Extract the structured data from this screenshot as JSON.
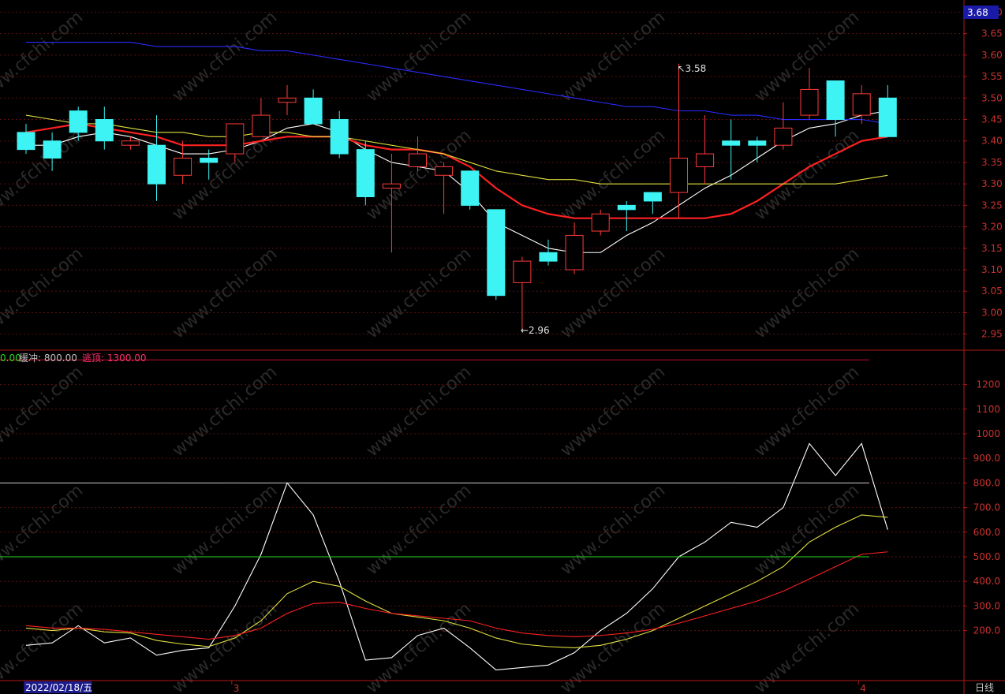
{
  "chart_data": {
    "type": "candlestick",
    "period_label": "日线",
    "watermark": "www.cfchi.com",
    "x_labels": [
      {
        "index": 1,
        "text": "2022/02/18/五"
      },
      {
        "index": 8,
        "text": "3"
      },
      {
        "index": 32,
        "text": "4"
      }
    ],
    "price_panel": {
      "current_price_label": "3.68",
      "ylim": [
        2.92,
        3.71
      ],
      "yticks": [
        "3.70",
        "3.65",
        "3.60",
        "3.55",
        "3.50",
        "3.45",
        "3.40",
        "3.35",
        "3.30",
        "3.25",
        "3.20",
        "3.15",
        "3.10",
        "3.05",
        "3.00",
        "2.95"
      ],
      "high_marker": {
        "index": 25,
        "text": "3.58"
      },
      "low_marker": {
        "index": 19,
        "text": "2.96"
      },
      "candles": [
        {
          "o": 3.42,
          "h": 3.44,
          "l": 3.37,
          "c": 3.38
        },
        {
          "o": 3.4,
          "h": 3.42,
          "l": 3.33,
          "c": 3.36
        },
        {
          "o": 3.47,
          "h": 3.48,
          "l": 3.4,
          "c": 3.42
        },
        {
          "o": 3.45,
          "h": 3.48,
          "l": 3.38,
          "c": 3.4
        },
        {
          "o": 3.39,
          "h": 3.41,
          "l": 3.38,
          "c": 3.4
        },
        {
          "o": 3.39,
          "h": 3.46,
          "l": 3.26,
          "c": 3.3
        },
        {
          "o": 3.32,
          "h": 3.4,
          "l": 3.3,
          "c": 3.36
        },
        {
          "o": 3.36,
          "h": 3.38,
          "l": 3.31,
          "c": 3.35
        },
        {
          "o": 3.37,
          "h": 3.4,
          "l": 3.35,
          "c": 3.44
        },
        {
          "o": 3.41,
          "h": 3.5,
          "l": 3.41,
          "c": 3.46
        },
        {
          "o": 3.49,
          "h": 3.53,
          "l": 3.46,
          "c": 3.5
        },
        {
          "o": 3.5,
          "h": 3.52,
          "l": 3.44,
          "c": 3.44
        },
        {
          "o": 3.45,
          "h": 3.47,
          "l": 3.36,
          "c": 3.37
        },
        {
          "o": 3.38,
          "h": 3.4,
          "l": 3.25,
          "c": 3.27
        },
        {
          "o": 3.29,
          "h": 3.37,
          "l": 3.14,
          "c": 3.3
        },
        {
          "o": 3.34,
          "h": 3.41,
          "l": 3.33,
          "c": 3.37
        },
        {
          "o": 3.32,
          "h": 3.35,
          "l": 3.23,
          "c": 3.34
        },
        {
          "o": 3.33,
          "h": 3.33,
          "l": 3.24,
          "c": 3.25
        },
        {
          "o": 3.24,
          "h": 3.24,
          "l": 3.03,
          "c": 3.04
        },
        {
          "o": 3.07,
          "h": 3.13,
          "l": 2.96,
          "c": 3.12
        },
        {
          "o": 3.14,
          "h": 3.17,
          "l": 3.11,
          "c": 3.12
        },
        {
          "o": 3.1,
          "h": 3.21,
          "l": 3.09,
          "c": 3.18
        },
        {
          "o": 3.19,
          "h": 3.24,
          "l": 3.18,
          "c": 3.23
        },
        {
          "o": 3.25,
          "h": 3.26,
          "l": 3.19,
          "c": 3.24
        },
        {
          "o": 3.28,
          "h": 3.28,
          "l": 3.23,
          "c": 3.26
        },
        {
          "o": 3.28,
          "h": 3.58,
          "l": 3.22,
          "c": 3.36
        },
        {
          "o": 3.34,
          "h": 3.46,
          "l": 3.3,
          "c": 3.37
        },
        {
          "o": 3.4,
          "h": 3.45,
          "l": 3.31,
          "c": 3.39
        },
        {
          "o": 3.4,
          "h": 3.41,
          "l": 3.35,
          "c": 3.39
        },
        {
          "o": 3.39,
          "h": 3.49,
          "l": 3.38,
          "c": 3.43
        },
        {
          "o": 3.46,
          "h": 3.57,
          "l": 3.45,
          "c": 3.52
        },
        {
          "o": 3.54,
          "h": 3.54,
          "l": 3.41,
          "c": 3.45
        },
        {
          "o": 3.46,
          "h": 3.53,
          "l": 3.44,
          "c": 3.51
        },
        {
          "o": 3.5,
          "h": 3.53,
          "l": 3.41,
          "c": 3.41
        }
      ],
      "lines": [
        {
          "color": "#ffffff",
          "values": [
            3.39,
            3.39,
            3.41,
            3.42,
            3.41,
            3.39,
            3.37,
            3.37,
            3.38,
            3.4,
            3.43,
            3.44,
            3.42,
            3.38,
            3.35,
            3.34,
            3.33,
            3.28,
            3.21,
            3.18,
            3.15,
            3.14,
            3.14,
            3.18,
            3.21,
            3.25,
            3.29,
            3.32,
            3.36,
            3.4,
            3.43,
            3.44,
            3.46,
            3.47
          ]
        },
        {
          "color": "#ff2020",
          "values": [
            3.42,
            3.43,
            3.44,
            3.43,
            3.42,
            3.41,
            3.39,
            3.39,
            3.39,
            3.4,
            3.41,
            3.41,
            3.41,
            3.39,
            3.38,
            3.38,
            3.37,
            3.34,
            3.29,
            3.25,
            3.23,
            3.22,
            3.22,
            3.22,
            3.22,
            3.22,
            3.22,
            3.23,
            3.26,
            3.3,
            3.34,
            3.37,
            3.4,
            3.41
          ]
        },
        {
          "color": "#e0e040",
          "values": [
            3.46,
            3.45,
            3.44,
            3.44,
            3.43,
            3.42,
            3.42,
            3.41,
            3.41,
            3.42,
            3.42,
            3.41,
            3.41,
            3.4,
            3.39,
            3.38,
            3.37,
            3.35,
            3.33,
            3.32,
            3.31,
            3.31,
            3.3,
            3.3,
            3.3,
            3.3,
            3.3,
            3.3,
            3.3,
            3.3,
            3.3,
            3.3,
            3.31,
            3.32
          ]
        },
        {
          "color": "#2a2aff",
          "values": [
            3.63,
            3.63,
            3.63,
            3.63,
            3.63,
            3.62,
            3.62,
            3.62,
            3.62,
            3.61,
            3.61,
            3.6,
            3.59,
            3.58,
            3.57,
            3.56,
            3.55,
            3.54,
            3.53,
            3.52,
            3.51,
            3.5,
            3.49,
            3.48,
            3.48,
            3.47,
            3.47,
            3.46,
            3.46,
            3.45,
            3.45,
            3.45,
            3.45,
            3.44
          ]
        }
      ]
    },
    "indicator_panel": {
      "legend": [
        {
          "text": "0.00",
          "color": "#22dd22"
        },
        {
          "text": "缓冲: 800.00",
          "color": "#c0c0c0"
        },
        {
          "text": "逃顶: 1300.00",
          "color": "#ff3070"
        }
      ],
      "ylim": [
        0,
        1330
      ],
      "yticks": [
        "1200",
        "1100",
        "1000",
        "900.0",
        "800.0",
        "700.0",
        "600.0",
        "500.0",
        "400.0",
        "300.0",
        "200.0"
      ],
      "hlines": [
        {
          "value": 1300,
          "color": "#c01030"
        },
        {
          "value": 800,
          "color": "#c8c8c8"
        },
        {
          "value": 500,
          "color": "#22dd22"
        }
      ],
      "lines": [
        {
          "color": "#ffffff",
          "values": [
            140,
            150,
            220,
            150,
            170,
            100,
            120,
            130,
            300,
            510,
            800,
            670,
            400,
            80,
            90,
            180,
            210,
            130,
            40,
            50,
            60,
            110,
            200,
            270,
            370,
            500,
            560,
            640,
            620,
            700,
            960,
            830,
            960,
            610
          ]
        },
        {
          "color": "#e0e040",
          "values": [
            210,
            200,
            210,
            195,
            190,
            160,
            145,
            135,
            170,
            240,
            350,
            400,
            380,
            320,
            270,
            255,
            240,
            210,
            170,
            145,
            135,
            130,
            140,
            165,
            200,
            250,
            300,
            350,
            400,
            460,
            560,
            620,
            670,
            660
          ]
        },
        {
          "color": "#ff2020",
          "values": [
            220,
            210,
            210,
            205,
            195,
            185,
            175,
            165,
            180,
            210,
            270,
            310,
            315,
            290,
            270,
            260,
            250,
            240,
            210,
            190,
            180,
            175,
            180,
            190,
            205,
            230,
            260,
            290,
            320,
            360,
            410,
            460,
            510,
            520
          ]
        }
      ]
    }
  }
}
